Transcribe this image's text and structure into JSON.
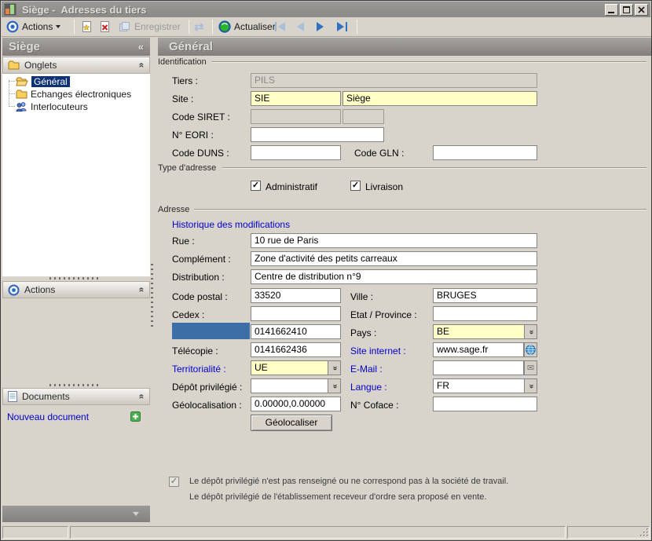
{
  "window": {
    "title": "Siège -  Adresses du tiers"
  },
  "toolbar": {
    "actions_label": "Actions",
    "enregistrer_label": "Enregistrer",
    "actualiser_label": "Actualiser"
  },
  "sidebar": {
    "title": "Siège",
    "onglets": {
      "header": "Onglets",
      "items": [
        {
          "label": "Général",
          "selected": true
        },
        {
          "label": "Echanges électroniques",
          "selected": false
        },
        {
          "label": "Interlocuteurs",
          "selected": false
        }
      ]
    },
    "actions": {
      "header": "Actions"
    },
    "documents": {
      "header": "Documents",
      "new_link": "Nouveau document"
    }
  },
  "main": {
    "header": "Général",
    "identification": {
      "title": "Identification",
      "tiers": {
        "label": "Tiers :",
        "value": "PILS"
      },
      "site": {
        "label": "Site :",
        "code": "SIE",
        "name": "Siège"
      },
      "siret": {
        "label": "Code SIRET :",
        "value": "",
        "value2": ""
      },
      "eori": {
        "label": "N° EORI :",
        "value": ""
      },
      "duns": {
        "label": "Code DUNS :",
        "value": ""
      },
      "gln": {
        "label": "Code GLN :",
        "value": ""
      }
    },
    "type_adresse": {
      "title": "Type d'adresse",
      "administratif": {
        "label": "Administratif",
        "checked": true
      },
      "livraison": {
        "label": "Livraison",
        "checked": true
      }
    },
    "adresse": {
      "title": "Adresse",
      "historique_link": "Historique des modifications",
      "rue": {
        "label": "Rue :",
        "value": "10 rue de Paris"
      },
      "complement": {
        "label": "Complément :",
        "value": "Zone d'activité des petits carreaux"
      },
      "distribution": {
        "label": "Distribution :",
        "value": "Centre de distribution n°9"
      },
      "code_postal": {
        "label": "Code postal :",
        "value": "33520"
      },
      "ville": {
        "label": "Ville :",
        "value": "BRUGES"
      },
      "cedex": {
        "label": "Cedex :",
        "value": ""
      },
      "etat_province": {
        "label": "Etat / Province :",
        "value": ""
      },
      "telephone": {
        "value": "0141662410"
      },
      "pays": {
        "label": "Pays :",
        "value": "BE"
      },
      "telecopie": {
        "label": "Télécopie :",
        "value": "0141662436"
      },
      "site_internet": {
        "label": "Site internet :",
        "value": "www.sage.fr"
      },
      "territorialite": {
        "label": "Territorialité :",
        "value": "UE"
      },
      "email": {
        "label": "E-Mail :",
        "value": ""
      },
      "depot_privilegie": {
        "label": "Dépôt privilégié :",
        "value": ""
      },
      "langue": {
        "label": "Langue :",
        "value": "FR"
      },
      "geolocalisation": {
        "label": "Géolocalisation :",
        "value": "0.00000,0.00000"
      },
      "coface": {
        "label": "N° Coface :",
        "value": ""
      },
      "geolocaliser_button": "Géolocaliser"
    },
    "notes": {
      "line1": "Le dépôt privilégié n'est pas renseigné ou ne correspond pas à la société de travail.",
      "line2": "Le dépôt privilégié de l'établissement receveur d'ordre sera proposé en vente."
    }
  },
  "glyphs": {
    "dbl_left": "«",
    "dbl_right": "»",
    "check": "✓",
    "refresh": "⇄",
    "envelope": "✉"
  },
  "colors": {
    "link_blue": "#0000cc",
    "selection_blue": "#0d3176",
    "highlight_block": "#3d6ea5",
    "field_yellow": "#ffffc6",
    "titlebar_gray": "#918f8b"
  }
}
